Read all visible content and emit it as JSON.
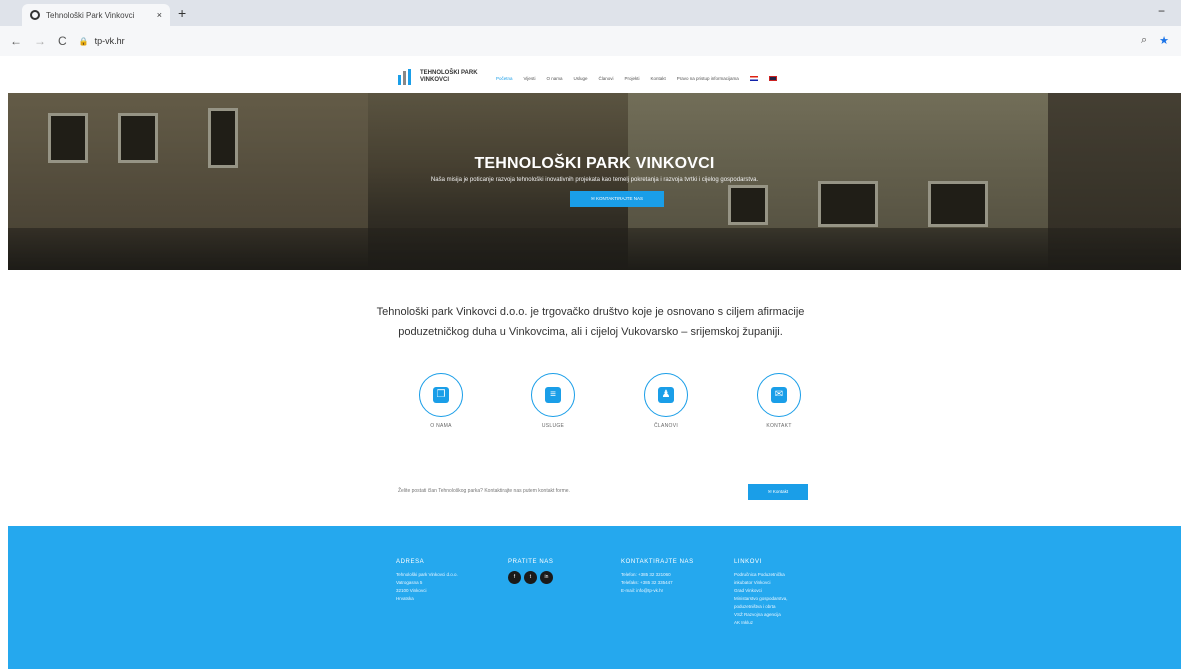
{
  "browser": {
    "tab_title": "Tehnološki Park Vinkovci",
    "tab_close": "×",
    "new_tab": "+",
    "url": "tp-vk.hr",
    "back": "←",
    "forward": "→",
    "reload": "C"
  },
  "header": {
    "logo_line1": "TEHNOLOŠKI PARK",
    "logo_line2": "VINKOVCI",
    "nav": [
      "Početna",
      "Vijesti",
      "O nama",
      "Usluge",
      "Članovi",
      "Projekti",
      "Kontakt",
      "Pravo na pristup informacijama"
    ]
  },
  "hero": {
    "title": "TEHNOLOŠKI PARK VINKOVCI",
    "mission": "Naša misija je poticanje razvoja tehnološki inovativnih projekata kao temelj pokretanja i razvoja tvrtki i cijelog gospodarstva.",
    "cta": "✉ KONTAKTIRAJTE NAS"
  },
  "intro": {
    "line1": "Tehnološki park Vinkovci d.o.o. je trgovačko društvo koje je osnovano s ciljem afirmacije",
    "line2": "poduzetničkog duha u Vinkovcima, ali i cijeloj Vukovarsko – srijemskoj županiji."
  },
  "features": [
    {
      "label": "O NAMA",
      "icon": "chat-icon",
      "glyph": "❐"
    },
    {
      "label": "USLUGE",
      "icon": "document-icon",
      "glyph": "≡"
    },
    {
      "label": "ČLANOVI",
      "icon": "users-icon",
      "glyph": "♟"
    },
    {
      "label": "KONTAKT",
      "icon": "envelope-icon",
      "glyph": "✉"
    }
  ],
  "member": {
    "text": "Želite postati član Tehnološkog parka? Kontaktirajte nas putem kontakt forme.",
    "button": "✉ Kontakt"
  },
  "footer": {
    "address_head": "ADRESA",
    "address_lines": [
      "Tehnološki park Vinkovci d.o.o.",
      "Vatrogasna 5",
      "32100 Vinkovci",
      "Hrvatska"
    ],
    "follow_head": "PRATITE NAS",
    "contact_head": "KONTAKTIRAJTE NAS",
    "contact_lines": [
      "Telefon: +385 32 321060",
      "Telefaks: +385 32 335447",
      "E-mail: info@tp-vk.hr"
    ],
    "links_head": "LINKOVI",
    "links": [
      "Područnica Poduzetnička",
      "inkubator Vinkovci",
      "Grad Vinkovci",
      "Ministarstvo gospodarstva,",
      "poduzetništva i obrta",
      "VSŽ Razvojna agencija",
      "AK Inkluz"
    ]
  },
  "colors": {
    "accent": "#1a9ee8",
    "footer_bg": "#25a8ee"
  }
}
